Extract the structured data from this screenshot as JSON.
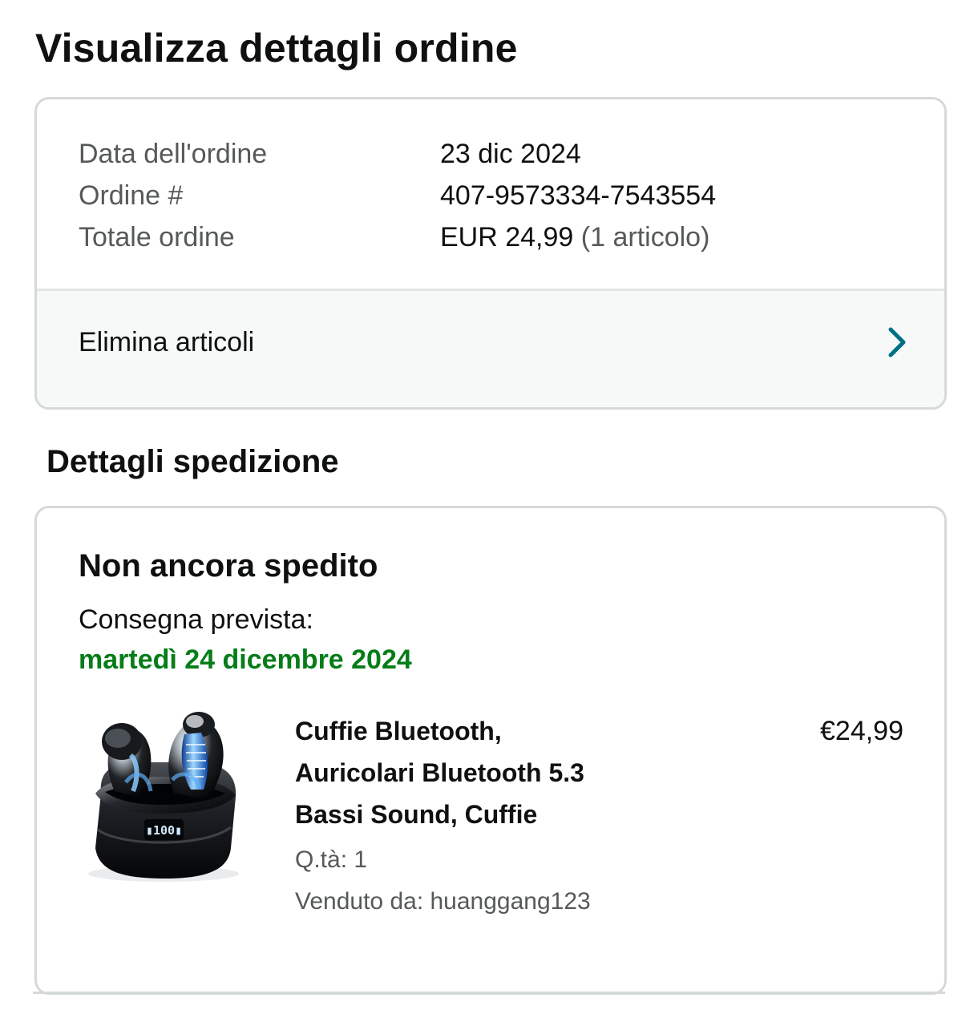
{
  "page": {
    "title": "Visualizza dettagli ordine"
  },
  "order_summary": {
    "rows": [
      {
        "label": "Data dell'ordine",
        "value": "23 dic 2024"
      },
      {
        "label": "Ordine #",
        "value": "407-9573334-7543554"
      },
      {
        "label": "Totale ordine",
        "value": "EUR 24,99",
        "value_extra": "(1 articolo)"
      }
    ],
    "action": {
      "label": "Elimina articoli",
      "icon": "chevron-right-icon"
    }
  },
  "shipping": {
    "section_title": "Dettagli spedizione",
    "status": "Non ancora spedito",
    "delivery_label": "Consegna prevista:",
    "delivery_date": "martedì 24 dicembre 2024",
    "item": {
      "image_icon": "wireless-earbuds-image",
      "title_lines": [
        "Cuffie Bluetooth,",
        "Auricolari Bluetooth 5.3",
        "Bassi Sound, Cuffie"
      ],
      "quantity": "Q.tà: 1",
      "seller": "Venduto da: huanggang123",
      "price": "€24,99"
    }
  },
  "colors": {
    "text": "#0f1111",
    "muted": "#565959",
    "border": "#d5d9d9",
    "action_background": "#f7f8f8",
    "delivery_green": "#067d18",
    "link_teal": "#007185"
  }
}
